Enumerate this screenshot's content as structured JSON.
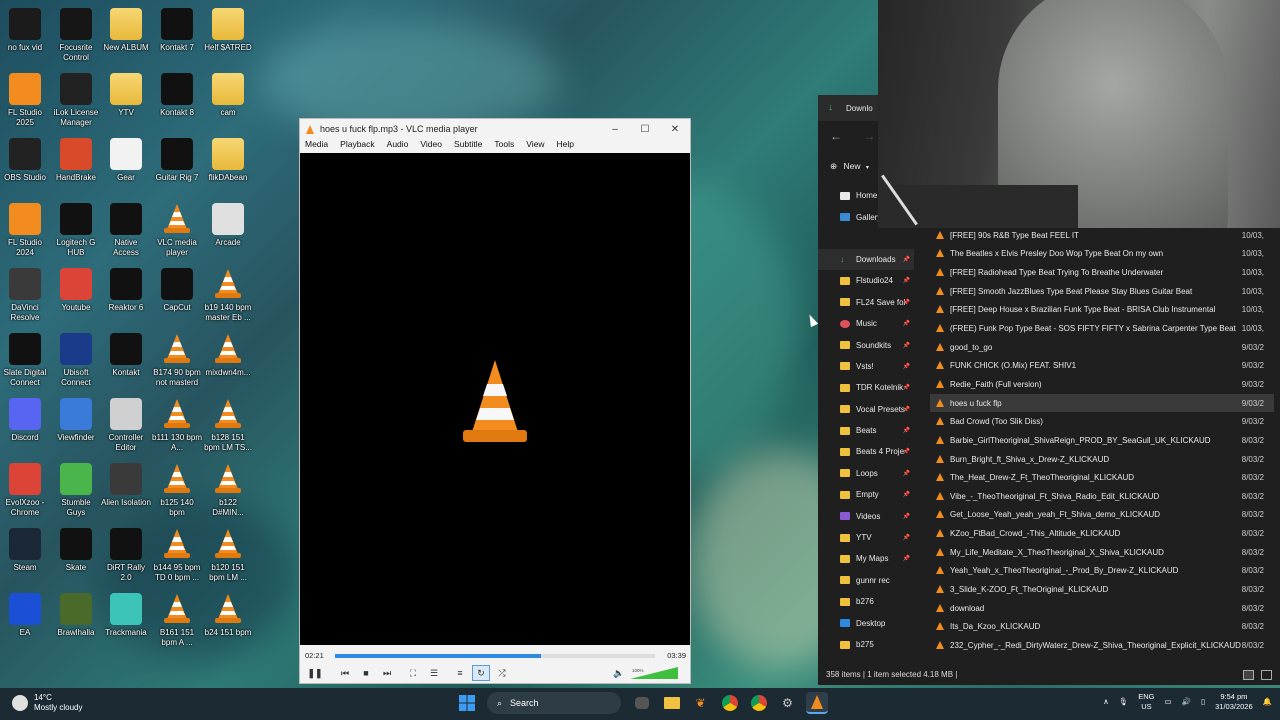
{
  "desktop": {
    "icons": [
      {
        "label": "no fux vid",
        "icon": "video-icon",
        "color": "#1b1b1b"
      },
      {
        "label": "Focusrite Control",
        "icon": "focusrite-icon",
        "color": "#161616"
      },
      {
        "label": "New ALBUM",
        "icon": "folder-icon",
        "color": "#f0c040"
      },
      {
        "label": "Kontakt 7",
        "icon": "kontakt-icon",
        "color": "#111111"
      },
      {
        "label": "Helf $ATRED",
        "icon": "folder-icon",
        "color": "#f0c040"
      },
      {
        "label": "FL Studio 2025",
        "icon": "fl-studio-icon",
        "color": "#f28c1e"
      },
      {
        "label": "iLok License Manager",
        "icon": "ilok-icon",
        "color": "#222222"
      },
      {
        "label": "YTV",
        "icon": "folder-icon",
        "color": "#f0c040"
      },
      {
        "label": "Kontakt 8",
        "icon": "kontakt-icon",
        "color": "#111111"
      },
      {
        "label": "cam",
        "icon": "folder-icon",
        "color": "#f0c040"
      },
      {
        "label": "OBS Studio",
        "icon": "obs-icon",
        "color": "#222222"
      },
      {
        "label": "HandBrake",
        "icon": "handbrake-icon",
        "color": "#d84a2a"
      },
      {
        "label": "Gear",
        "icon": "document-icon",
        "color": "#f2f2f2"
      },
      {
        "label": "Guitar Rig 7",
        "icon": "guitar-rig-icon",
        "color": "#111111"
      },
      {
        "label": "flikDAbean",
        "icon": "folder-icon",
        "color": "#f0c040"
      },
      {
        "label": "FL Studio 2024",
        "icon": "fl-studio-icon",
        "color": "#f28c1e"
      },
      {
        "label": "Logitech G HUB",
        "icon": "logitech-icon",
        "color": "#111111"
      },
      {
        "label": "Native Access",
        "icon": "native-access-icon",
        "color": "#111111"
      },
      {
        "label": "VLC media player",
        "icon": "vlc-icon",
        "color": "#f28c1e"
      },
      {
        "label": "Arcade",
        "icon": "arcade-icon",
        "color": "#e0e0e0"
      },
      {
        "label": "DaVinci Resolve",
        "icon": "davinci-icon",
        "color": "#3a3a3a"
      },
      {
        "label": "Youtube",
        "icon": "chrome-icon",
        "color": "#db4437"
      },
      {
        "label": "Reaktor 6",
        "icon": "reaktor-icon",
        "color": "#111111"
      },
      {
        "label": "CapCut",
        "icon": "capcut-icon",
        "color": "#111111"
      },
      {
        "label": "b19 140 bpm master Eb ...",
        "icon": "vlc-icon",
        "color": "#f28c1e"
      },
      {
        "label": "Slate Digital Connect",
        "icon": "slate-icon",
        "color": "#111111"
      },
      {
        "label": "Ubisoft Connect",
        "icon": "ubisoft-icon",
        "color": "#1a3a8a"
      },
      {
        "label": "Kontakt",
        "icon": "kontakt-icon",
        "color": "#111111"
      },
      {
        "label": "B174 90 bpm not masterd",
        "icon": "vlc-icon",
        "color": "#f28c1e"
      },
      {
        "label": "mixdwn4m...",
        "icon": "vlc-icon",
        "color": "#f28c1e"
      },
      {
        "label": "Discord",
        "icon": "discord-icon",
        "color": "#5865f2"
      },
      {
        "label": "Viewfinder",
        "icon": "viewfinder-icon",
        "color": "#3a7ad9"
      },
      {
        "label": "Controller Editor",
        "icon": "controller-icon",
        "color": "#d0d0d0"
      },
      {
        "label": "b111 130 bpm A...",
        "icon": "vlc-icon",
        "color": "#f28c1e"
      },
      {
        "label": "b128 151 bpm LM TS...",
        "icon": "vlc-icon",
        "color": "#f28c1e"
      },
      {
        "label": "EvolXzoo - Chrome",
        "icon": "chrome-icon",
        "color": "#db4437"
      },
      {
        "label": "Stumble Guys",
        "icon": "stumble-icon",
        "color": "#4ab54a"
      },
      {
        "label": "Alien Isolation",
        "icon": "alien-icon",
        "color": "#3a3a3a"
      },
      {
        "label": "b125 140 bpm",
        "icon": "vlc-icon",
        "color": "#f28c1e"
      },
      {
        "label": "b122 D#MIN...",
        "icon": "vlc-icon",
        "color": "#f28c1e"
      },
      {
        "label": "Steam",
        "icon": "steam-icon",
        "color": "#1b2838"
      },
      {
        "label": "Skate",
        "icon": "skate-icon",
        "color": "#111111"
      },
      {
        "label": "DiRT Rally 2.0",
        "icon": "dirt-icon",
        "color": "#111111"
      },
      {
        "label": "b144 95 bpm TD 0 bpm ...",
        "icon": "vlc-icon",
        "color": "#f28c1e"
      },
      {
        "label": "b120 151 bpm LM ...",
        "icon": "vlc-icon",
        "color": "#f28c1e"
      },
      {
        "label": "EA",
        "icon": "ea-icon",
        "color": "#1a4fd6"
      },
      {
        "label": "Brawlhalla",
        "icon": "brawlhalla-icon",
        "color": "#4a6a2a"
      },
      {
        "label": "Trackmania",
        "icon": "trackmania-icon",
        "color": "#3cc4b8"
      },
      {
        "label": "B161 151 bpm A ...",
        "icon": "vlc-icon",
        "color": "#f28c1e"
      },
      {
        "label": "b24 151 bpm",
        "icon": "vlc-icon",
        "color": "#f28c1e"
      }
    ]
  },
  "vlc": {
    "title": "hoes u fuck flp.mp3 - VLC media player",
    "menu": [
      "Media",
      "Playback",
      "Audio",
      "Video",
      "Subtitle",
      "Tools",
      "View",
      "Help"
    ],
    "elapsed": "02:21",
    "duration": "03:39",
    "progress": 0.645,
    "volume_label": "100%",
    "volume": 1.0
  },
  "explorer": {
    "tab_title": "Downlo",
    "new_label": "New",
    "sidebar": [
      {
        "label": "Home",
        "icon": "home-icon",
        "pinned": false
      },
      {
        "label": "Gallery",
        "icon": "gallery-icon",
        "pinned": false
      },
      {
        "label": "Downloads",
        "icon": "download-icon",
        "pinned": true
      },
      {
        "label": "Flstudio24",
        "icon": "folder-icon",
        "pinned": true
      },
      {
        "label": "FL24 Save fol",
        "icon": "folder-icon",
        "pinned": true
      },
      {
        "label": "Music",
        "icon": "music-icon",
        "pinned": true
      },
      {
        "label": "Soundkits",
        "icon": "folder-icon",
        "pinned": true
      },
      {
        "label": "Vsts!",
        "icon": "folder-icon",
        "pinned": true
      },
      {
        "label": "TDR Kotelnik",
        "icon": "folder-icon",
        "pinned": true
      },
      {
        "label": "Vocal Presets",
        "icon": "folder-icon",
        "pinned": true
      },
      {
        "label": "Beats",
        "icon": "folder-icon",
        "pinned": true
      },
      {
        "label": "Beats 4 Proje",
        "icon": "folder-icon",
        "pinned": true
      },
      {
        "label": "Loops",
        "icon": "folder-icon",
        "pinned": true
      },
      {
        "label": "Empty",
        "icon": "folder-icon",
        "pinned": true
      },
      {
        "label": "Videos",
        "icon": "videos-icon",
        "pinned": true
      },
      {
        "label": "YTV",
        "icon": "folder-icon",
        "pinned": true
      },
      {
        "label": "My Maps",
        "icon": "folder-icon",
        "pinned": true
      },
      {
        "label": "gunnr rec",
        "icon": "folder-icon",
        "pinned": false
      },
      {
        "label": "b276",
        "icon": "folder-icon",
        "pinned": false
      },
      {
        "label": "Desktop",
        "icon": "desktop-icon",
        "pinned": false
      },
      {
        "label": "b275",
        "icon": "folder-icon",
        "pinned": false
      }
    ],
    "files": [
      {
        "name": "[FREE] 90s R&B Type Beat FEEL IT",
        "date": "10/03,"
      },
      {
        "name": "The Beatles x Elvis Presley Doo Wop Type Beat  On my own",
        "date": "10/03,"
      },
      {
        "name": "[FREE] Radiohead Type Beat  Trying To Breathe Underwater",
        "date": "10/03,"
      },
      {
        "name": "[FREE] Smooth JazzBlues Type Beat  Please Stay  Blues Guitar Beat",
        "date": "10/03,"
      },
      {
        "name": "[FREE] Deep House x Brazilian Funk Type Beat - BRISA  Club Instrumental",
        "date": "10/03,"
      },
      {
        "name": "(FREE) Funk Pop Type Beat - SOS  FIFTY FIFTY x Sabrina Carpenter Type Beat",
        "date": "10/03,"
      },
      {
        "name": "good_to_go",
        "date": "9/03/2"
      },
      {
        "name": "FUNK CHICK (O.Mix) FEAT. SHIV1",
        "date": "9/03/2"
      },
      {
        "name": "Redie_Faith (Full version)",
        "date": "9/03/2"
      },
      {
        "name": "hoes u fuck flp",
        "date": "9/03/2"
      },
      {
        "name": "Bad Crowd (Too Slik Diss)",
        "date": "9/03/2"
      },
      {
        "name": "Barbie_GirlTheoriginal_ShivaReign_PROD_BY_SeaGull_UK_KLICKAUD",
        "date": "8/03/2"
      },
      {
        "name": "Burn_Bright_ft_Shiva_x_Drew-Z_KLICKAUD",
        "date": "8/03/2"
      },
      {
        "name": "The_Heat_Drew-Z_Ft_TheoTheoriginal_KLICKAUD",
        "date": "8/03/2"
      },
      {
        "name": "Vibe_-_TheoTheoriginal_Ft_Shiva_Radio_Edit_KLICKAUD",
        "date": "8/03/2"
      },
      {
        "name": "Get_Loose_Yeah_yeah_yeah_Ft_Shiva_demo_KLICKAUD",
        "date": "8/03/2"
      },
      {
        "name": "KZoo_FtBad_Crowd_-This_Altitude_KLICKAUD",
        "date": "8/03/2"
      },
      {
        "name": "My_Life_Meditate_X_TheoTheoriginal_X_Shiva_KLICKAUD",
        "date": "8/03/2"
      },
      {
        "name": "Yeah_Yeah_x_TheoTheoriginal_-_Prod_By_Drew-Z_KLICKAUD",
        "date": "8/03/2"
      },
      {
        "name": "3_Slide_K-ZOO_Ft_TheOriginal_KLICKAUD",
        "date": "8/03/2"
      },
      {
        "name": "download",
        "date": "8/03/2"
      },
      {
        "name": "Its_Da_Kzoo_KLICKAUD",
        "date": "8/03/2"
      },
      {
        "name": "232_Cypher_-_Redi_DirtyWaterz_Drew-Z_Shiva_Theoriginal_Explicit_KLICKAUD",
        "date": "8/03/2"
      }
    ],
    "selected_index": 9,
    "status": "358 items  |  1 item selected  4.18 MB  |"
  },
  "taskbar": {
    "temp": "14°C",
    "weather": "Mostly cloudy",
    "search_label": "Search",
    "lang_top": "ENG",
    "lang_bottom": "US",
    "time": "9:54 pm",
    "date": "31/03/2026"
  },
  "colors": {
    "vlc_orange": "#f28c1e",
    "accent_blue": "#2d8ae0",
    "explorer_bg": "#1f1f1f",
    "taskbar_bg": "#1c2a33"
  }
}
